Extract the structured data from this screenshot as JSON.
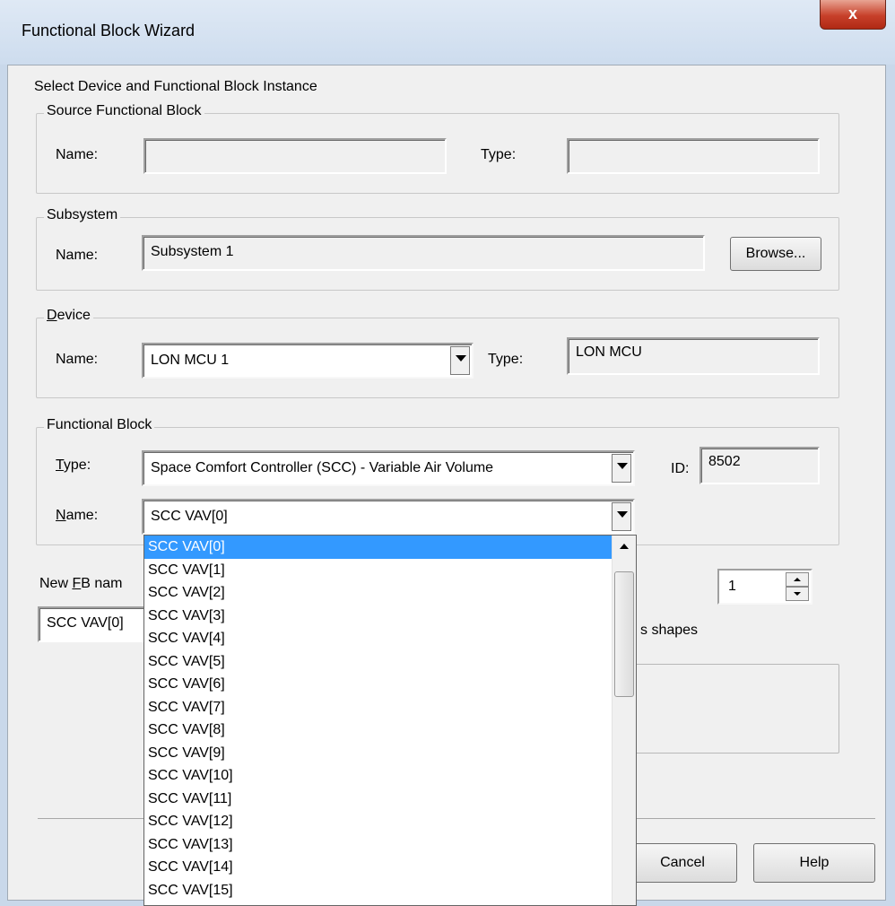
{
  "window": {
    "title": "Functional Block Wizard",
    "close_label": "x"
  },
  "instructions": "Select Device and Functional Block Instance",
  "source_fb": {
    "legend": "Source Functional Block",
    "name_label": "Name:",
    "name_value": "",
    "type_label": "Type:",
    "type_value": ""
  },
  "subsystem": {
    "legend": "Subsystem",
    "name_label": "Name:",
    "name_value": "Subsystem 1",
    "browse_label": "Browse..."
  },
  "device": {
    "legend": "Device",
    "name_label": "Name:",
    "name_value": "LON MCU 1",
    "type_label": "Type:",
    "type_value": "LON MCU"
  },
  "functional_block": {
    "legend": "Functional Block",
    "type_label": "Type:",
    "type_value": "Space Comfort Controller (SCC) - Variable Air Volume",
    "id_label": "ID:",
    "id_value": "8502",
    "name_label": "Name:",
    "name_value": "SCC VAV[0]"
  },
  "new_fb": {
    "label_partial": "New FB nam",
    "value_partial": "SCC VAV[0]",
    "count_value": "1",
    "shapes_partial": "s shapes"
  },
  "dropdown": {
    "selected_index": 0,
    "items": [
      "SCC VAV[0]",
      "SCC VAV[1]",
      "SCC VAV[2]",
      "SCC VAV[3]",
      "SCC VAV[4]",
      "SCC VAV[5]",
      "SCC VAV[6]",
      "SCC VAV[7]",
      "SCC VAV[8]",
      "SCC VAV[9]",
      "SCC VAV[10]",
      "SCC VAV[11]",
      "SCC VAV[12]",
      "SCC VAV[13]",
      "SCC VAV[14]",
      "SCC VAV[15]"
    ]
  },
  "buttons": {
    "cancel": "Cancel",
    "help": "Help"
  }
}
